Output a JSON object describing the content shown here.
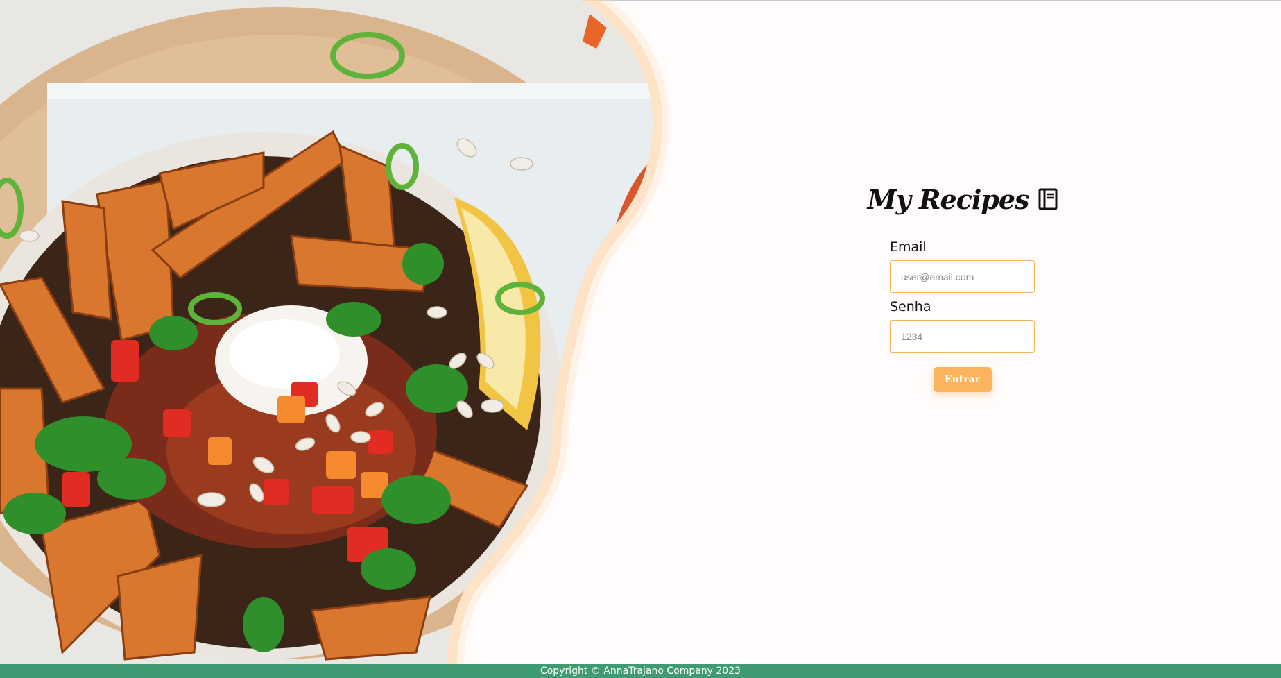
{
  "brand": {
    "title": "My Recipes",
    "icon": "notebook-icon"
  },
  "form": {
    "email_label": "Email",
    "email_placeholder": "user@email.com",
    "password_label": "Senha",
    "password_placeholder": "1234",
    "submit_label": "Entrar"
  },
  "footer": {
    "text": "Copyright © AnnaTrajano Company 2023"
  },
  "colors": {
    "accent": "#fbb35e",
    "input_border": "#f6b25d",
    "footer_bg": "#3e9b72",
    "page_bg": "#fffcfb"
  }
}
